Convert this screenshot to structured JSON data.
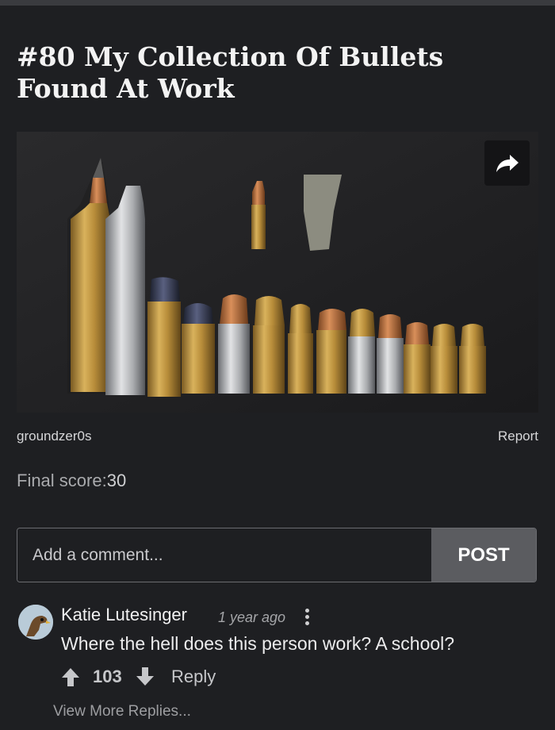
{
  "post": {
    "title": "#80 My Collection Of Bullets Found At Work",
    "author": "groundzer0s",
    "report_label": "Report",
    "score_label": "Final score:",
    "score_value": "30",
    "image_alt": "photo of bullets"
  },
  "comment_form": {
    "placeholder": "Add a comment...",
    "post_label": "POST"
  },
  "comments": [
    {
      "user": "Katie Lutesinger",
      "time": "1 year ago",
      "text": "Where the hell does this person work? A school?",
      "votes": "103",
      "reply_label": "Reply"
    }
  ],
  "view_more_label": "View More Replies...",
  "icons": {
    "share": "share-arrow-icon",
    "upvote": "arrow-up-icon",
    "downvote": "arrow-down-icon",
    "menu": "vertical-dots-icon"
  },
  "colors": {
    "background": "#1e1f22",
    "post_button": "#5b5c60"
  }
}
